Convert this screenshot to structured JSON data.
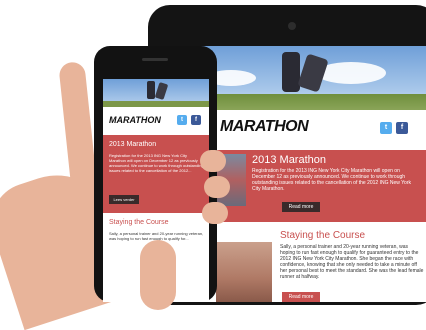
{
  "tablet": {
    "logo": "MARATHON",
    "logo_sub": "",
    "article1": {
      "title": "2013 Marathon",
      "text": "Registration for the 2013 ING New York City Marathon will open on December 12 as previously announced. We continue to work through outstanding issues related to the cancellation of the 2012 ING New York City Marathon.",
      "button": "Read more"
    },
    "article2": {
      "title": "Staying the Course",
      "text": "Sally, a personal trainer and 20-year running veteran, was hoping to run fast enough to qualify for guaranteed entry to the 2012 ING New York City Marathon. She began the race with confidence, knowing that she only needed to take a minute off her personal best to meet the standard. She was the lead female runner at halfway.",
      "button": "Read more"
    }
  },
  "phone": {
    "logo": "MARATHON",
    "article1": {
      "title": "2013 Marathon",
      "text": "Registration for the 2013 ING New York City Marathon will open on December 12 as previously announced. We continue to work through outstanding issues related to the cancellation of the 2012...",
      "button": "Lees verder"
    },
    "article2": {
      "title": "Staying the Course",
      "text": "Sally, a personal trainer and 20-year running veteran, was hoping to run fast enough to qualify for..."
    }
  },
  "icons": {
    "twitter": "twitter-icon",
    "facebook": "facebook-icon"
  },
  "colors": {
    "accent_red": "#c8504f",
    "twitter_blue": "#55acee",
    "facebook_blue": "#3b5998"
  }
}
